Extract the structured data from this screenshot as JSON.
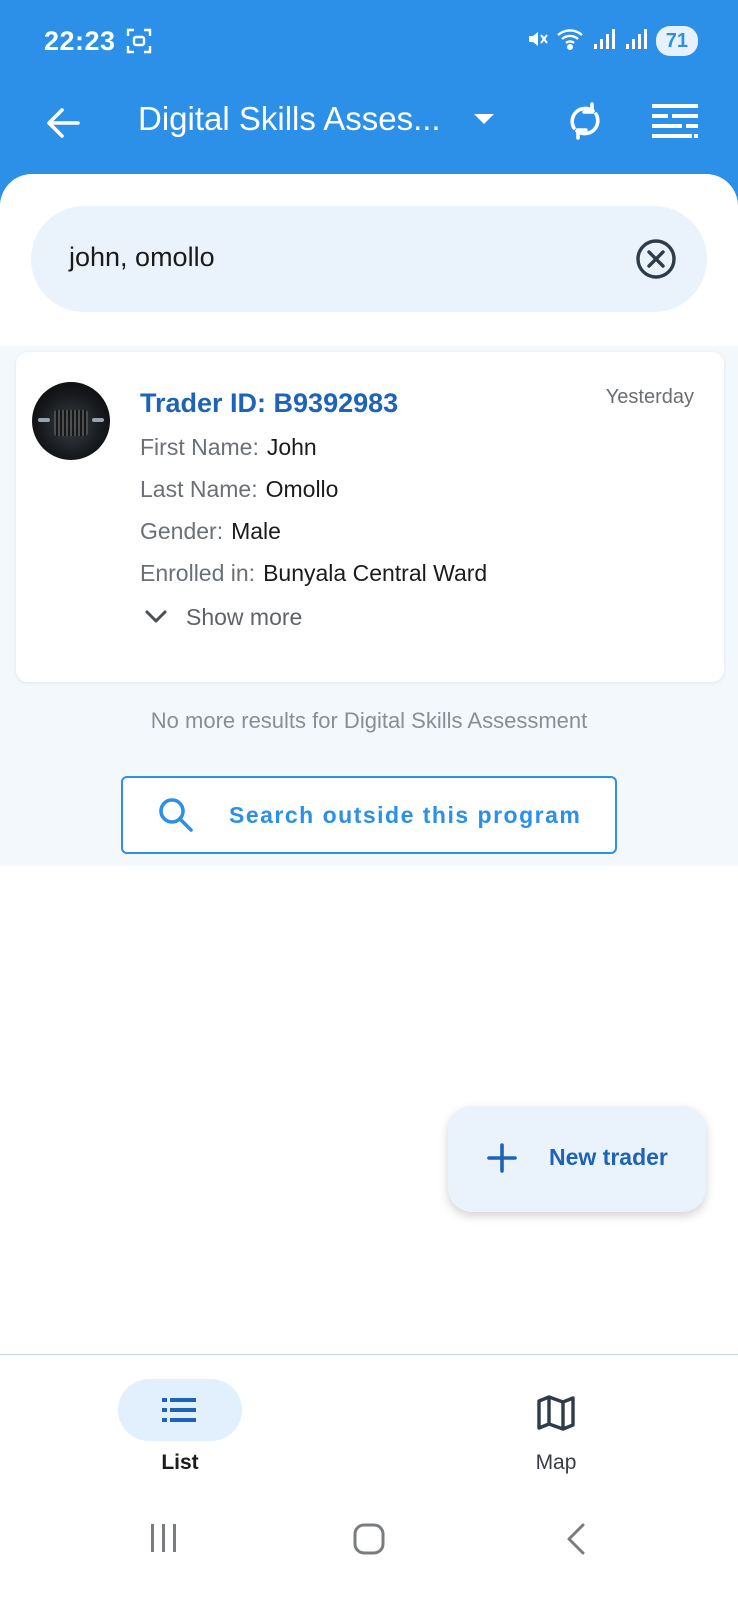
{
  "status_bar": {
    "time": "22:23",
    "battery": "71"
  },
  "app_bar": {
    "title": "Digital Skills Asses...",
    "icons": [
      "back-arrow-icon",
      "dropdown-arrow-icon",
      "sync-icon",
      "filter-icon"
    ]
  },
  "search": {
    "value": "john, omollo"
  },
  "result": {
    "trader_id": "Trader ID: B9392983",
    "date": "Yesterday",
    "fields": [
      {
        "label": "First Name:",
        "value": "John"
      },
      {
        "label": "Last Name:",
        "value": "Omollo"
      },
      {
        "label": "Gender:",
        "value": "Male"
      },
      {
        "label": "Enrolled in:",
        "value": "Bunyala Central Ward"
      }
    ],
    "show_more": "Show more"
  },
  "no_more_results": "No more results for Digital Skills Assessment",
  "search_outside_label": "Search outside this program",
  "fab_label": "New trader",
  "bottom_nav": {
    "list_label": "List",
    "map_label": "Map",
    "active": "List"
  },
  "colors": {
    "primary": "#2c8fe8",
    "primary_dark": "#1e63b6",
    "surface_tint": "#eaf3fc"
  }
}
